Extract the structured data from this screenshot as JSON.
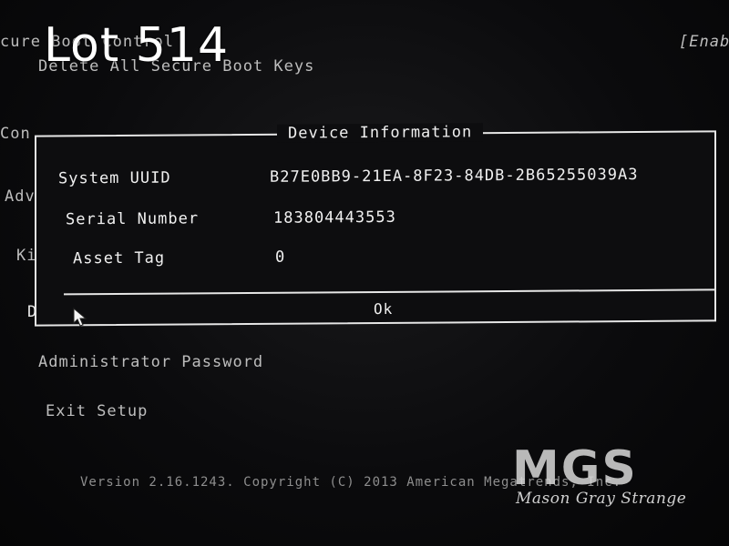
{
  "overlay": {
    "lot_label": "Lot 514"
  },
  "background_menu": {
    "secure_boot_control": "cure Boot Control",
    "delete_keys": "Delete All Secure Boot Keys",
    "enabled_value": "[Enab",
    "con_fragment": "Con",
    "adv_fragment": "Adv",
    "kio_fragment": "Kio",
    "dev_fragment": "Dev",
    "administrator_password": "Administrator Password",
    "exit_setup": "Exit Setup",
    "version": "Version 2.16.1243. Copyright (C) 2013 American Megatrends, Inc."
  },
  "dialog": {
    "title": "Device Information",
    "rows": [
      {
        "label": "System UUID",
        "value": "B27E0BB9-21EA-8F23-84DB-2B65255039A3"
      },
      {
        "label": "Serial Number",
        "value": "183804443553"
      },
      {
        "label": "Asset Tag",
        "value": "0"
      }
    ],
    "ok_label": "Ok"
  },
  "watermark": {
    "logo_letters": "MGS",
    "tagline": "Mason Gray Strange"
  },
  "colors": {
    "background": "#0b0b0d",
    "text": "#f0f0f0",
    "border": "#e6e6e6"
  },
  "icons": {
    "pointer": "mouse-pointer-icon"
  }
}
